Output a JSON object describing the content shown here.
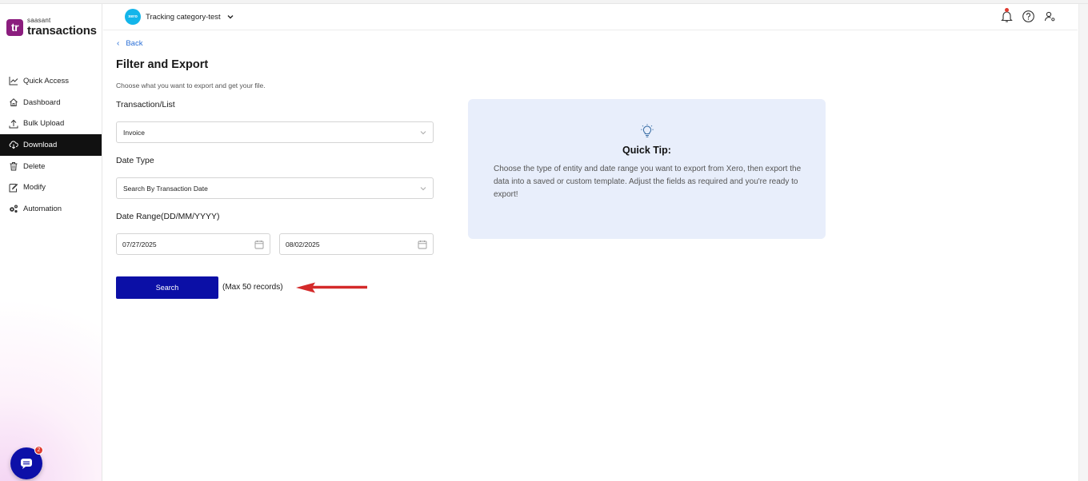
{
  "brand": {
    "small": "saasant",
    "big": "transactions",
    "mark": "tr"
  },
  "sidebar": {
    "items": [
      {
        "label": "Quick Access",
        "icon": "chart-line-icon"
      },
      {
        "label": "Dashboard",
        "icon": "home-icon"
      },
      {
        "label": "Bulk Upload",
        "icon": "upload-icon"
      },
      {
        "label": "Download",
        "icon": "cloud-download-icon",
        "active": true
      },
      {
        "label": "Delete",
        "icon": "trash-icon"
      },
      {
        "label": "Modify",
        "icon": "edit-icon"
      },
      {
        "label": "Automation",
        "icon": "gears-icon"
      }
    ]
  },
  "chat": {
    "badge_count": "2"
  },
  "header": {
    "org_logo_text": "xero",
    "org_name": "Tracking category-test"
  },
  "main": {
    "back_label": "Back",
    "title": "Filter and Export",
    "subtitle": "Choose what you want to export and get your file.",
    "transaction_label": "Transaction/List",
    "transaction_value": "Invoice",
    "date_type_label": "Date Type",
    "date_type_value": "Search By Transaction Date",
    "date_range_label": "Date Range(DD/MM/YYYY)",
    "date_from": "07/27/2025",
    "date_to": "08/02/2025",
    "search_label": "Search",
    "max_note": "(Max 50 records)"
  },
  "tip": {
    "title": "Quick Tip:",
    "text": "Choose the type of entity and date range you want to export from Xero, then export the data into a saved or custom template. Adjust the fields as required and you're ready to export!"
  },
  "colors": {
    "primary_button": "#0b0fa6",
    "active_nav": "#111111",
    "link": "#2a6fd6",
    "tip_bg": "#e8eefb",
    "arrow": "#d42a2a",
    "brand": "#8b1d7e"
  }
}
